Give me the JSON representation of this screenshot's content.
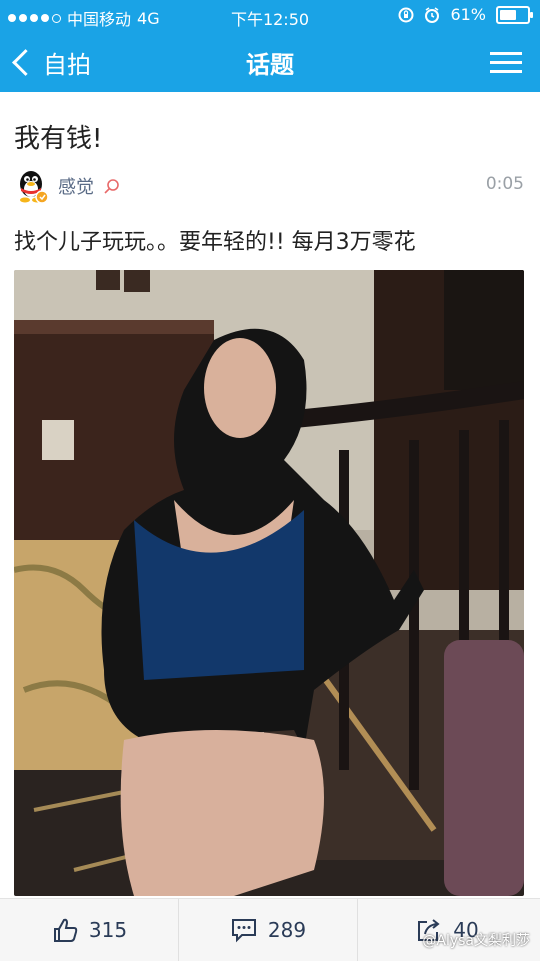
{
  "status_bar": {
    "carrier": "中国移动",
    "network": "4G",
    "time": "下午12:50",
    "battery": "61%",
    "battery_level": 0.61
  },
  "nav": {
    "back_label": "自拍",
    "title": "话题"
  },
  "post": {
    "title": "我有钱!",
    "author": "感觉",
    "time": "0:05",
    "text": "找个儿子玩玩。。要年轻的!! 每月3万零花"
  },
  "actions": {
    "likes": "315",
    "comments": "289",
    "shares": "40"
  },
  "watermark": "@Alysa文梨利莎",
  "colors": {
    "accent": "#1aa3e6",
    "author": "#5a6b86",
    "time": "#9aa0a6"
  }
}
